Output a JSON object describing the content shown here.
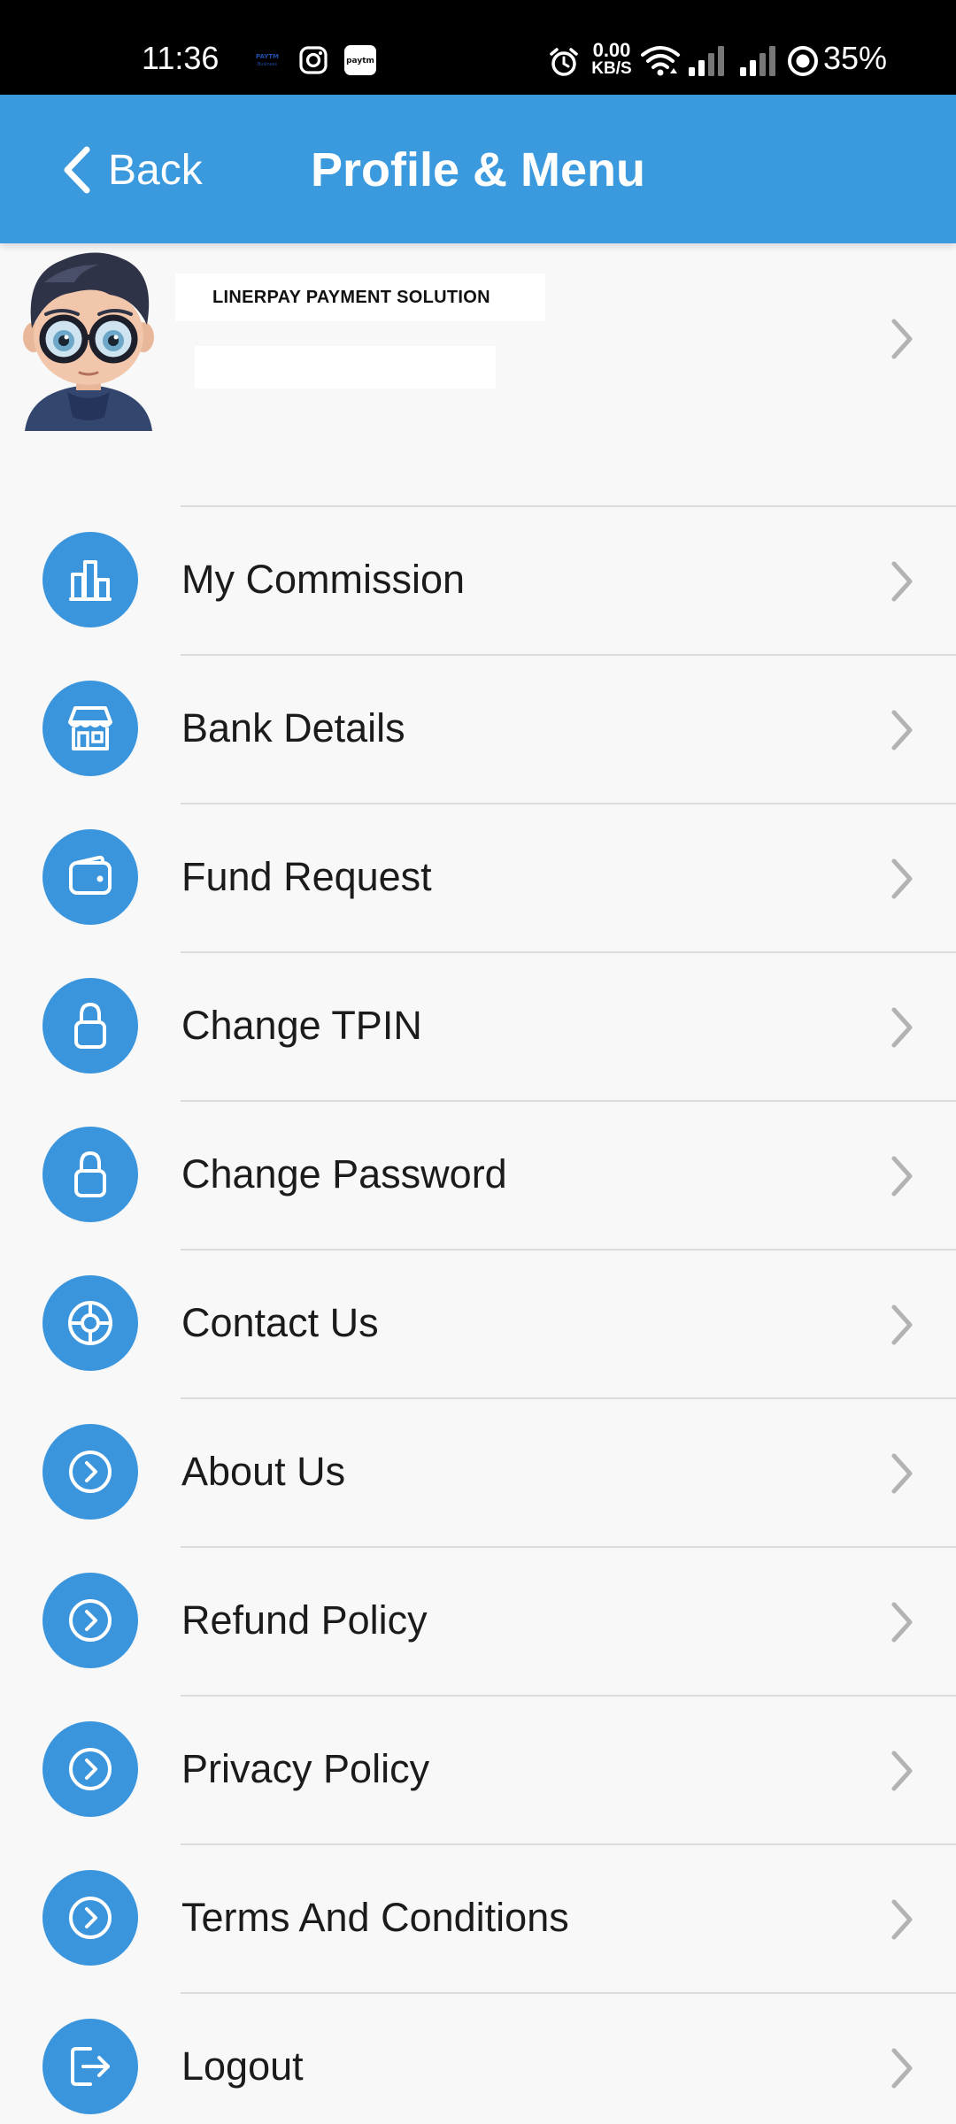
{
  "status_bar": {
    "time": "11:36",
    "net_speed_value": "0.00",
    "net_speed_unit": "KB/S",
    "battery": "35%",
    "icons": [
      "paytm-icon",
      "instagram-icon",
      "paytm-app-icon",
      "alarm-icon",
      "wifi-icon",
      "signal-icon",
      "signal-icon",
      "battery-saver-icon"
    ]
  },
  "header": {
    "back_label": "Back",
    "title": "Profile & Menu",
    "color": "#3b9ade"
  },
  "profile": {
    "company_name": "LINERPAY PAYMENT SOLUTION"
  },
  "menu": [
    {
      "label": "My Commission",
      "icon": "bar-chart-icon"
    },
    {
      "label": "Bank Details",
      "icon": "store-icon"
    },
    {
      "label": "Fund Request",
      "icon": "wallet-icon"
    },
    {
      "label": "Change TPIN",
      "icon": "lock-icon"
    },
    {
      "label": "Change Password",
      "icon": "lock-icon"
    },
    {
      "label": "Contact Us",
      "icon": "lifebuoy-icon"
    },
    {
      "label": "About Us",
      "icon": "chevron-circle-icon"
    },
    {
      "label": "Refund Policy",
      "icon": "chevron-circle-icon"
    },
    {
      "label": "Privacy Policy",
      "icon": "chevron-circle-icon"
    },
    {
      "label": "Terms And Conditions",
      "icon": "chevron-circle-icon"
    },
    {
      "label": "Logout",
      "icon": "logout-icon"
    }
  ],
  "colors": {
    "accent": "#3b95dd",
    "background": "#f8f8f8",
    "divider": "#dcdcdc",
    "chevron": "#b3b3b3"
  }
}
